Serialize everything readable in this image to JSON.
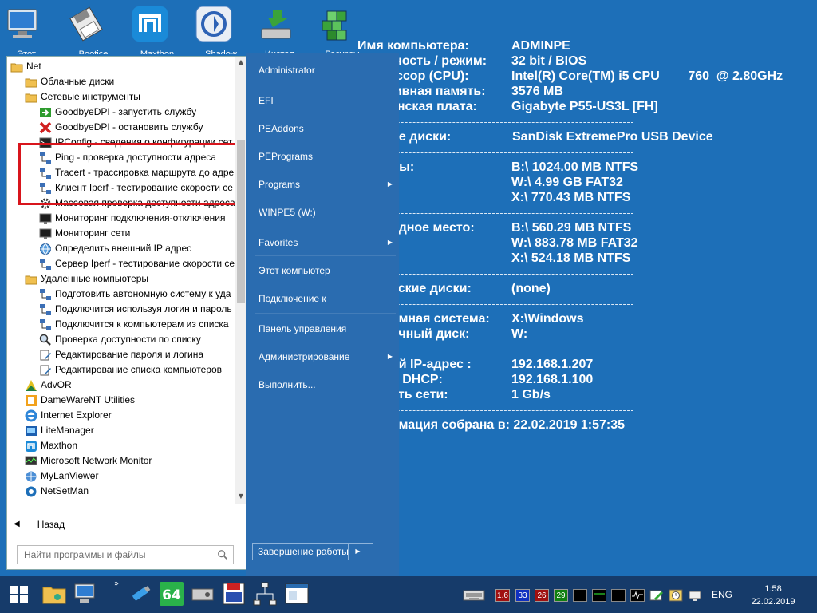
{
  "desktop": {
    "icons": [
      {
        "name": "computer",
        "label": "Этот..."
      },
      {
        "name": "floppy",
        "label": "Bootice"
      },
      {
        "name": "maxthon",
        "label": "Maxthon"
      },
      {
        "name": "shadow",
        "label": "Shadow"
      },
      {
        "name": "install",
        "label": "Инстал..."
      },
      {
        "name": "rubik",
        "label": "Ресурсы"
      }
    ]
  },
  "sysinfo": {
    "rows": [
      {
        "key": "Имя компьютера:",
        "value": "ADMINPE"
      },
      {
        "key": "дность / режим:",
        "value": "32 bit / BIOS"
      },
      {
        "key": "ссор (CPU):",
        "value": "Intel(R) Core(TM) i5 CPU        760  @ 2.80GHz"
      },
      {
        "key": "тивная память:",
        "value": "3576 MB"
      },
      {
        "key": "инская плата:",
        "value": "Gigabyte P55-US3L [FH]"
      },
      {
        "key": "ие диски:",
        "value": "SanDisk ExtremePro USB Device"
      },
      {
        "key": "лы:",
        "value": "B:\\ 1024.00 MB NTFS"
      },
      {
        "key": "",
        "value": "W:\\ 4.99 GB FAT32"
      },
      {
        "key": "",
        "value": "X:\\ 770.43 MB NTFS"
      },
      {
        "key": "одное место:",
        "value": "B:\\ 560.29 MB NTFS"
      },
      {
        "key": "",
        "value": "W:\\ 883.78 MB FAT32"
      },
      {
        "key": "",
        "value": "X:\\ 524.18 MB NTFS"
      },
      {
        "key": "еские диски:",
        "value": "(none)"
      },
      {
        "key": "омная система:",
        "value": "X:\\Windows"
      },
      {
        "key": "очный диск:",
        "value": "W:"
      },
      {
        "key": "ой IP-адрес :",
        "value": "192.168.1.207"
      },
      {
        "key": "р DHCP:",
        "value": "192.168.1.100"
      },
      {
        "key": "сть сети:",
        "value": "1 Gb/s"
      }
    ],
    "footer": "омация собрана в: 22.02.2019 1:57:35"
  },
  "start_menu": {
    "tree": [
      {
        "label": "Net",
        "icon": "folder-icon"
      },
      {
        "label": "Облачные диски",
        "icon": "folder-icon"
      },
      {
        "label": "Сетевые инструменты",
        "icon": "folder-icon"
      },
      {
        "label": "GoodbyeDPI - запустить службу",
        "icon": "green-arrow-icon"
      },
      {
        "label": "GoodbyeDPI - остановить службу",
        "icon": "red-x-icon"
      },
      {
        "label": "IPConfig - сведения о конфигурации сет",
        "icon": "console-icon"
      },
      {
        "label": "Ping - проверка доступности адреса",
        "icon": "network-icon"
      },
      {
        "label": "Tracert - трассировка маршрута до адре",
        "icon": "network-icon"
      },
      {
        "label": "Клиент Iperf - тестирование скорости се",
        "icon": "network-icon"
      },
      {
        "label": "Массовая проверка доступности адреса",
        "icon": "gear-icon"
      },
      {
        "label": "Мониторинг подключения-отключения",
        "icon": "monitor-icon"
      },
      {
        "label": "Мониторинг сети",
        "icon": "monitor-icon"
      },
      {
        "label": "Определить внешний IP адрес",
        "icon": "globe-icon"
      },
      {
        "label": "Сервер Iperf - тестирование скорости се",
        "icon": "network-icon"
      },
      {
        "label": "Удаленные компьютеры",
        "icon": "folder-icon"
      },
      {
        "label": "Подготовить автономную систему к уда",
        "icon": "network-icon"
      },
      {
        "label": "Подключится используя логин и пароль",
        "icon": "network-icon"
      },
      {
        "label": "Подключится к компьютерам из списка",
        "icon": "network-icon"
      },
      {
        "label": "Проверка доступности по списку",
        "icon": "magnifier-icon"
      },
      {
        "label": "Редактирование пароля и логина",
        "icon": "edit-icon"
      },
      {
        "label": "Редактирование списка компьютеров",
        "icon": "edit-icon"
      },
      {
        "label": "AdvOR",
        "icon": "advor-icon"
      },
      {
        "label": "DameWareNT Utilities",
        "icon": "dameware-icon"
      },
      {
        "label": "Internet Explorer",
        "icon": "ie-icon"
      },
      {
        "label": "LiteManager",
        "icon": "litemanager-icon"
      },
      {
        "label": "Maxthon",
        "icon": "maxthon-icon"
      },
      {
        "label": "Microsoft Network Monitor",
        "icon": "netmon-icon"
      },
      {
        "label": "MyLanViewer",
        "icon": "mylanviewer-icon"
      },
      {
        "label": "NetSetMan",
        "icon": "netsetman-icon"
      }
    ],
    "back_label": "Назад",
    "search_placeholder": "Найти программы и файлы",
    "right_items": [
      {
        "label": "Administrator",
        "submenu": false
      },
      {
        "label": "EFI",
        "submenu": false
      },
      {
        "label": "PEAddons",
        "submenu": false
      },
      {
        "label": "PEPrograms",
        "submenu": false
      },
      {
        "label": "Programs",
        "submenu": true
      },
      {
        "label": "WINPE5 (W:)",
        "submenu": false
      },
      {
        "label": "Favorites",
        "submenu": true
      },
      {
        "label": "Этот компьютер",
        "submenu": false
      },
      {
        "label": "Подключение к",
        "submenu": false
      },
      {
        "label": "Панель управления",
        "submenu": false
      },
      {
        "label": "Администрирование",
        "submenu": true
      },
      {
        "label": "Выполнить...",
        "submenu": false
      }
    ],
    "shutdown_label": "Завершение работы"
  },
  "taskbar": {
    "tray_numbers": [
      {
        "text": "1.6",
        "color": "#a01010"
      },
      {
        "text": "33",
        "color": "#1030c0"
      },
      {
        "text": "26",
        "color": "#a01010"
      },
      {
        "text": "29",
        "color": "#108010"
      }
    ],
    "language": "ENG",
    "time": "1:58",
    "date": "22.02.2019"
  },
  "colors": {
    "desktop": "#1d6fb8",
    "menu_right": "#2a6cb0",
    "taskbar": "#163b6a",
    "highlight": "#d8151c"
  }
}
